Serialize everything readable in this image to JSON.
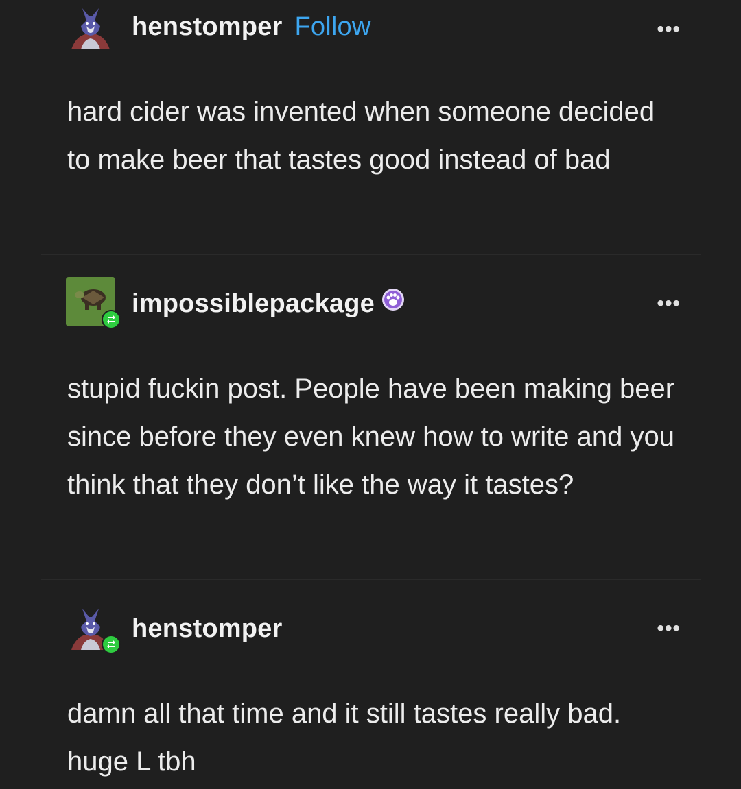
{
  "posts": [
    {
      "username": "henstomper",
      "follow_label": "Follow",
      "more_label": "•••",
      "avatar_icon": "fox-character-avatar",
      "text": "hard cider was invented when someone decided to make beer that tastes good instead of bad"
    },
    {
      "username": "impossiblepackage",
      "more_label": "•••",
      "avatar_icon": "turtle-avatar",
      "badge_icon": "paw-badge-icon",
      "reblog_icon": "reblog-icon",
      "text": "stupid fuckin post. People have been making beer since before they even knew how to write and you think that they don’t like the way it tastes?"
    },
    {
      "username": "henstomper",
      "more_label": "•••",
      "avatar_icon": "fox-character-avatar",
      "reblog_icon": "reblog-icon",
      "text": "damn all that time and it still tastes really bad. huge L tbh"
    }
  ],
  "colors": {
    "background": "#1f1f1f",
    "follow_link": "#3da6f0",
    "reblog_badge": "#2ecc40",
    "text": "#ececec"
  }
}
